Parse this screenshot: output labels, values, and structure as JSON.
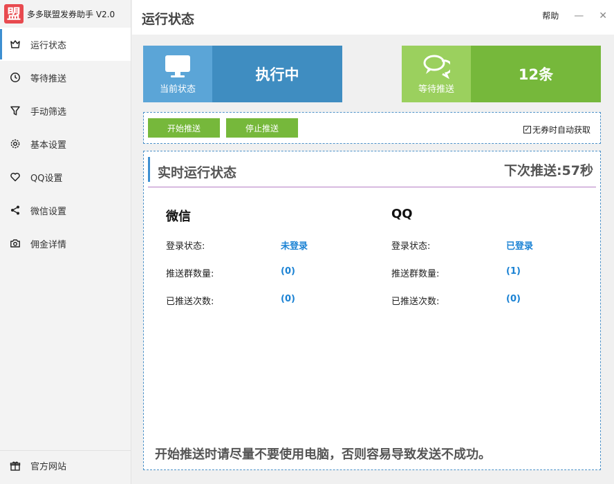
{
  "app": {
    "logo_char": "盟",
    "title": "多多联盟发券助手 V2.0"
  },
  "sidebar": {
    "items": [
      {
        "label": "运行状态",
        "icon": "dashboard-icon",
        "active": true
      },
      {
        "label": "等待推送",
        "icon": "clock-icon"
      },
      {
        "label": "手动筛选",
        "icon": "filter-icon"
      },
      {
        "label": "基本设置",
        "icon": "gear-icon"
      },
      {
        "label": "QQ设置",
        "icon": "heart-icon"
      },
      {
        "label": "微信设置",
        "icon": "share-icon"
      },
      {
        "label": "佣金详情",
        "icon": "camera-icon"
      }
    ],
    "bottom": {
      "label": "官方网站",
      "icon": "gift-icon"
    }
  },
  "header": {
    "title": "运行状态",
    "help_label": "帮助",
    "minimize_glyph": "—",
    "close_glyph": "✕"
  },
  "cards": {
    "current": {
      "label": "当前状态",
      "value": "执行中",
      "icon": "monitor-icon"
    },
    "pending": {
      "label": "等待推送",
      "value": "12条",
      "icon": "chat-icon"
    }
  },
  "controls": {
    "start_label": "开始推送",
    "stop_label": "停止推送",
    "auto_fetch_label": "无券时自动获取",
    "auto_fetch_checked": true,
    "check_glyph": "✓"
  },
  "status": {
    "title": "实时运行状态",
    "countdown": "下次推送:57秒",
    "wechat": {
      "title": "微信",
      "rows": [
        {
          "label": "登录状态:",
          "value": "未登录"
        },
        {
          "label": "推送群数量:",
          "value": "(0)"
        },
        {
          "label": "已推送次数:",
          "value": "(0)"
        }
      ]
    },
    "qq": {
      "title": "QQ",
      "rows": [
        {
          "label": "登录状态:",
          "value": "已登录"
        },
        {
          "label": "推送群数量:",
          "value": "(1)"
        },
        {
          "label": "已推送次数:",
          "value": "(0)"
        }
      ]
    },
    "warning": "开始推送时请尽量不要使用电脑，否则容易导致发送不成功。"
  },
  "colors": {
    "accent_blue": "#3f8dc1",
    "accent_green": "#76b83b",
    "value_blue": "#1a82d4",
    "logo_red": "#e84a4f"
  }
}
